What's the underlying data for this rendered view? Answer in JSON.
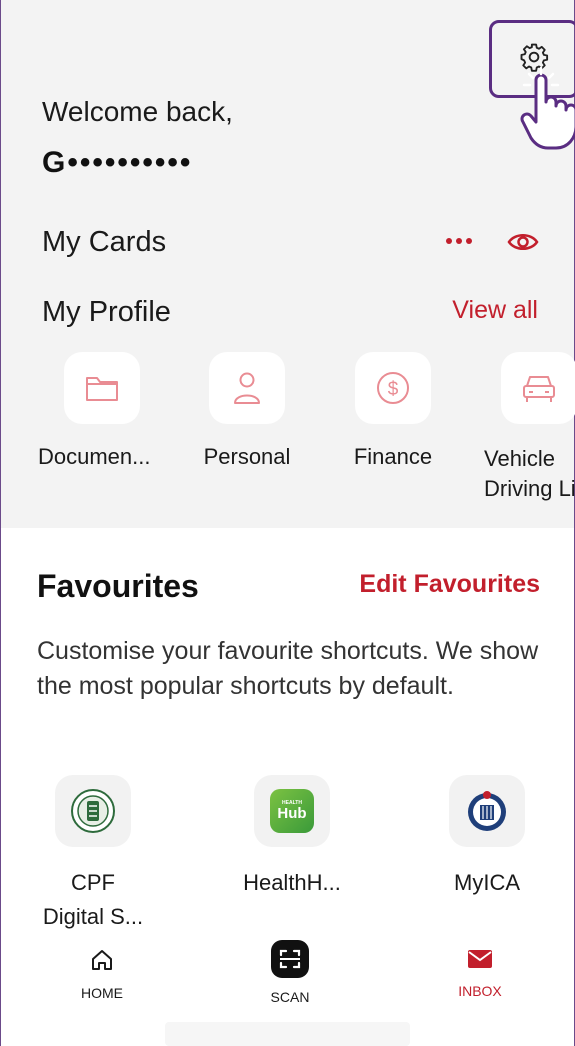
{
  "header": {
    "welcome_text": "Welcome back,",
    "masked_name": "G••••••••••"
  },
  "cards": {
    "title": "My Cards"
  },
  "profile": {
    "title": "My Profile",
    "view_all": "View all",
    "items": [
      {
        "label": "Documen...",
        "icon": "folder-icon"
      },
      {
        "label": "Personal",
        "icon": "person-icon"
      },
      {
        "label": "Finance",
        "icon": "dollar-icon"
      },
      {
        "label": "Vehicle\nDriving Li",
        "icon": "car-icon"
      }
    ]
  },
  "favourites": {
    "title": "Favourites",
    "edit_label": "Edit Favourites",
    "description": "Customise your favourite shortcuts. We show the most popular shortcuts by default.",
    "items": [
      {
        "label": "CPF\nDigital S...",
        "icon": "cpf-logo"
      },
      {
        "label": "HealthH...",
        "icon": "healthhub-logo",
        "logo_text": "Hub",
        "logo_small_text": "HEALTH"
      },
      {
        "label": "MyICA",
        "icon": "ica-logo"
      }
    ]
  },
  "bottom_nav": {
    "home": "HOME",
    "scan": "SCAN",
    "inbox": "INBOX"
  },
  "colors": {
    "accent_red": "#c21f2c",
    "highlight_purple": "#5a2d82",
    "icon_pink": "#e98c93"
  }
}
